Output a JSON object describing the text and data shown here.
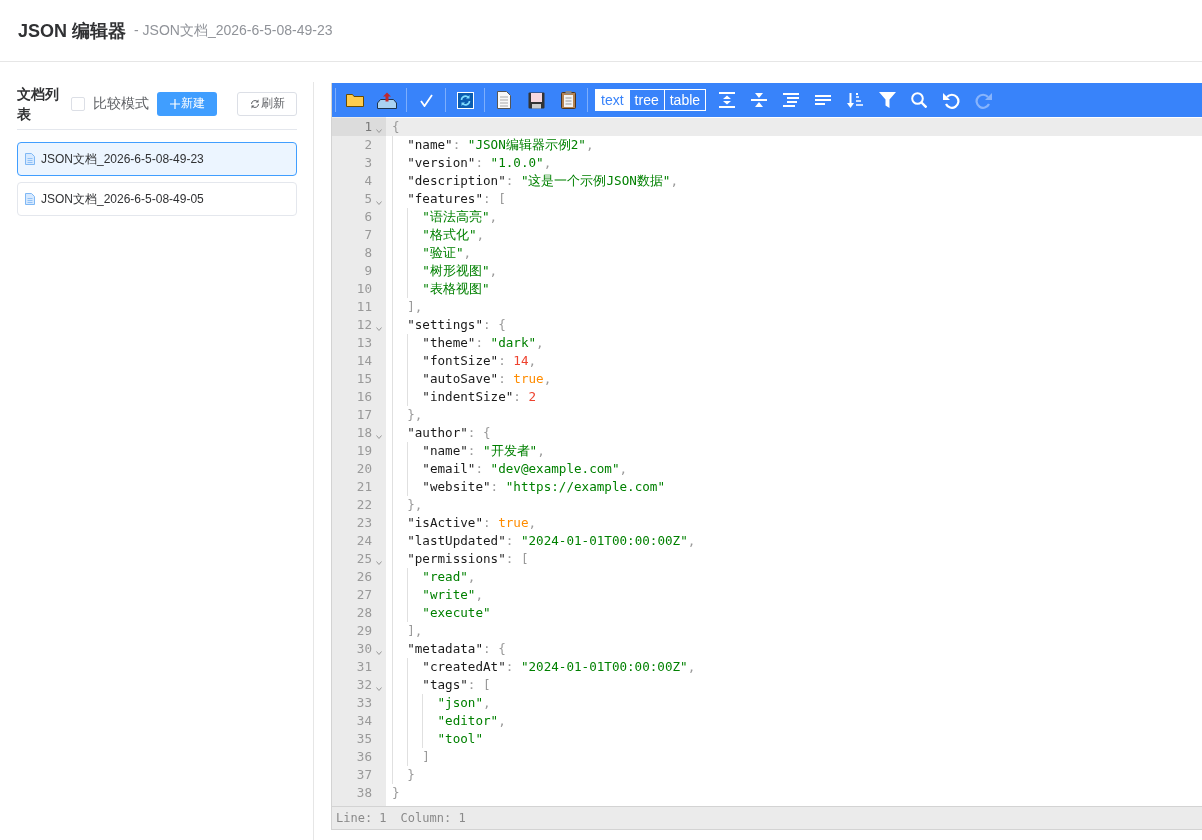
{
  "header": {
    "title": "JSON 编辑器",
    "subtitle": "- JSON文档_2026-6-5-08-49-23"
  },
  "sidebar": {
    "title": "文档列表",
    "compare": {
      "label": "比较模式",
      "checked": false
    },
    "new_button": "新建",
    "refresh_button": "刷新",
    "documents": [
      {
        "name": "JSON文档_2026-6-5-08-49-23",
        "selected": true
      },
      {
        "name": "JSON文档_2026-6-5-08-49-05",
        "selected": false
      }
    ]
  },
  "editor": {
    "toolbar": {
      "groups": [
        [
          {
            "kind": "open",
            "disabled": false
          },
          {
            "kind": "upload",
            "disabled": false
          }
        ],
        [
          {
            "kind": "validate",
            "disabled": false
          }
        ],
        [
          {
            "kind": "refresh",
            "disabled": false
          }
        ],
        [
          {
            "kind": "new",
            "disabled": false
          },
          {
            "kind": "save",
            "disabled": false
          },
          {
            "kind": "paste",
            "disabled": false
          }
        ]
      ],
      "modes": [
        {
          "label": "text",
          "selected": true
        },
        {
          "label": "tree",
          "selected": false
        },
        {
          "label": "table",
          "selected": false
        }
      ],
      "actions": [
        {
          "kind": "expand",
          "disabled": false
        },
        {
          "kind": "collapse",
          "disabled": false
        },
        {
          "kind": "format",
          "disabled": false
        },
        {
          "kind": "compact",
          "disabled": false
        },
        {
          "kind": "sort",
          "disabled": false
        },
        {
          "kind": "filter",
          "disabled": false
        },
        {
          "kind": "search",
          "disabled": false
        },
        {
          "kind": "undo",
          "disabled": false
        },
        {
          "kind": "redo",
          "disabled": true
        }
      ]
    },
    "lines": [
      {
        "number": "1",
        "active": true,
        "tokens": [
          {
            "kind": "bracket",
            "text": "{"
          }
        ],
        "children": [
          {
            "number": "2",
            "active": false,
            "tokens": [
              {
                "kind": "key",
                "text": "\"name\""
              },
              {
                "kind": "punct",
                "text": ": "
              },
              {
                "kind": "string",
                "text": "\"JSON编辑器示例2\""
              },
              {
                "kind": "punct",
                "text": ","
              }
            ]
          },
          {
            "number": "3",
            "active": false,
            "tokens": [
              {
                "kind": "key",
                "text": "\"version\""
              },
              {
                "kind": "punct",
                "text": ": "
              },
              {
                "kind": "string",
                "text": "\"1.0.0\""
              },
              {
                "kind": "punct",
                "text": ","
              }
            ]
          },
          {
            "number": "4",
            "active": false,
            "tokens": [
              {
                "kind": "key",
                "text": "\"description\""
              },
              {
                "kind": "punct",
                "text": ": "
              },
              {
                "kind": "string",
                "text": "\"这是一个示例JSON数据\""
              },
              {
                "kind": "punct",
                "text": ","
              }
            ]
          },
          {
            "number": "5",
            "active": false,
            "tokens": [
              {
                "kind": "key",
                "text": "\"features\""
              },
              {
                "kind": "punct",
                "text": ": "
              },
              {
                "kind": "bracket",
                "text": "["
              }
            ],
            "children": [
              {
                "number": "6",
                "active": false,
                "tokens": [
                  {
                    "kind": "string",
                    "text": "\"语法高亮\""
                  },
                  {
                    "kind": "punct",
                    "text": ","
                  }
                ]
              },
              {
                "number": "7",
                "active": false,
                "tokens": [
                  {
                    "kind": "string",
                    "text": "\"格式化\""
                  },
                  {
                    "kind": "punct",
                    "text": ","
                  }
                ]
              },
              {
                "number": "8",
                "active": false,
                "tokens": [
                  {
                    "kind": "string",
                    "text": "\"验证\""
                  },
                  {
                    "kind": "punct",
                    "text": ","
                  }
                ]
              },
              {
                "number": "9",
                "active": false,
                "tokens": [
                  {
                    "kind": "string",
                    "text": "\"树形视图\""
                  },
                  {
                    "kind": "punct",
                    "text": ","
                  }
                ]
              },
              {
                "number": "10",
                "active": false,
                "tokens": [
                  {
                    "kind": "string",
                    "text": "\"表格视图\""
                  }
                ]
              }
            ]
          },
          {
            "number": "11",
            "active": false,
            "tokens": [
              {
                "kind": "bracket",
                "text": "]"
              },
              {
                "kind": "punct",
                "text": ","
              }
            ]
          },
          {
            "number": "12",
            "active": false,
            "tokens": [
              {
                "kind": "key",
                "text": "\"settings\""
              },
              {
                "kind": "punct",
                "text": ": "
              },
              {
                "kind": "bracket",
                "text": "{"
              }
            ],
            "children": [
              {
                "number": "13",
                "active": false,
                "tokens": [
                  {
                    "kind": "key",
                    "text": "\"theme\""
                  },
                  {
                    "kind": "punct",
                    "text": ": "
                  },
                  {
                    "kind": "string",
                    "text": "\"dark\""
                  },
                  {
                    "kind": "punct",
                    "text": ","
                  }
                ]
              },
              {
                "number": "14",
                "active": false,
                "tokens": [
                  {
                    "kind": "key",
                    "text": "\"fontSize\""
                  },
                  {
                    "kind": "punct",
                    "text": ": "
                  },
                  {
                    "kind": "number",
                    "text": "14"
                  },
                  {
                    "kind": "punct",
                    "text": ","
                  }
                ]
              },
              {
                "number": "15",
                "active": false,
                "tokens": [
                  {
                    "kind": "key",
                    "text": "\"autoSave\""
                  },
                  {
                    "kind": "punct",
                    "text": ": "
                  },
                  {
                    "kind": "boolean",
                    "text": "true"
                  },
                  {
                    "kind": "punct",
                    "text": ","
                  }
                ]
              },
              {
                "number": "16",
                "active": false,
                "tokens": [
                  {
                    "kind": "key",
                    "text": "\"indentSize\""
                  },
                  {
                    "kind": "punct",
                    "text": ": "
                  },
                  {
                    "kind": "number",
                    "text": "2"
                  }
                ]
              }
            ]
          },
          {
            "number": "17",
            "active": false,
            "tokens": [
              {
                "kind": "bracket",
                "text": "}"
              },
              {
                "kind": "punct",
                "text": ","
              }
            ]
          },
          {
            "number": "18",
            "active": false,
            "tokens": [
              {
                "kind": "key",
                "text": "\"author\""
              },
              {
                "kind": "punct",
                "text": ": "
              },
              {
                "kind": "bracket",
                "text": "{"
              }
            ],
            "children": [
              {
                "number": "19",
                "active": false,
                "tokens": [
                  {
                    "kind": "key",
                    "text": "\"name\""
                  },
                  {
                    "kind": "punct",
                    "text": ": "
                  },
                  {
                    "kind": "string",
                    "text": "\"开发者\""
                  },
                  {
                    "kind": "punct",
                    "text": ","
                  }
                ]
              },
              {
                "number": "20",
                "active": false,
                "tokens": [
                  {
                    "kind": "key",
                    "text": "\"email\""
                  },
                  {
                    "kind": "punct",
                    "text": ": "
                  },
                  {
                    "kind": "string",
                    "text": "\"dev@example.com\""
                  },
                  {
                    "kind": "punct",
                    "text": ","
                  }
                ]
              },
              {
                "number": "21",
                "active": false,
                "tokens": [
                  {
                    "kind": "key",
                    "text": "\"website\""
                  },
                  {
                    "kind": "punct",
                    "text": ": "
                  },
                  {
                    "kind": "string",
                    "text": "\"https://example.com\""
                  }
                ]
              }
            ]
          },
          {
            "number": "22",
            "active": false,
            "tokens": [
              {
                "kind": "bracket",
                "text": "}"
              },
              {
                "kind": "punct",
                "text": ","
              }
            ]
          },
          {
            "number": "23",
            "active": false,
            "tokens": [
              {
                "kind": "key",
                "text": "\"isActive\""
              },
              {
                "kind": "punct",
                "text": ": "
              },
              {
                "kind": "boolean",
                "text": "true"
              },
              {
                "kind": "punct",
                "text": ","
              }
            ]
          },
          {
            "number": "24",
            "active": false,
            "tokens": [
              {
                "kind": "key",
                "text": "\"lastUpdated\""
              },
              {
                "kind": "punct",
                "text": ": "
              },
              {
                "kind": "string",
                "text": "\"2024-01-01T00:00:00Z\""
              },
              {
                "kind": "punct",
                "text": ","
              }
            ]
          },
          {
            "number": "25",
            "active": false,
            "tokens": [
              {
                "kind": "key",
                "text": "\"permissions\""
              },
              {
                "kind": "punct",
                "text": ": "
              },
              {
                "kind": "bracket",
                "text": "["
              }
            ],
            "children": [
              {
                "number": "26",
                "active": false,
                "tokens": [
                  {
                    "kind": "string",
                    "text": "\"read\""
                  },
                  {
                    "kind": "punct",
                    "text": ","
                  }
                ]
              },
              {
                "number": "27",
                "active": false,
                "tokens": [
                  {
                    "kind": "string",
                    "text": "\"write\""
                  },
                  {
                    "kind": "punct",
                    "text": ","
                  }
                ]
              },
              {
                "number": "28",
                "active": false,
                "tokens": [
                  {
                    "kind": "string",
                    "text": "\"execute\""
                  }
                ]
              }
            ]
          },
          {
            "number": "29",
            "active": false,
            "tokens": [
              {
                "kind": "bracket",
                "text": "]"
              },
              {
                "kind": "punct",
                "text": ","
              }
            ]
          },
          {
            "number": "30",
            "active": false,
            "tokens": [
              {
                "kind": "key",
                "text": "\"metadata\""
              },
              {
                "kind": "punct",
                "text": ": "
              },
              {
                "kind": "bracket",
                "text": "{"
              }
            ],
            "children": [
              {
                "number": "31",
                "active": false,
                "tokens": [
                  {
                    "kind": "key",
                    "text": "\"createdAt\""
                  },
                  {
                    "kind": "punct",
                    "text": ": "
                  },
                  {
                    "kind": "string",
                    "text": "\"2024-01-01T00:00:00Z\""
                  },
                  {
                    "kind": "punct",
                    "text": ","
                  }
                ]
              },
              {
                "number": "32",
                "active": false,
                "tokens": [
                  {
                    "kind": "key",
                    "text": "\"tags\""
                  },
                  {
                    "kind": "punct",
                    "text": ": "
                  },
                  {
                    "kind": "bracket",
                    "text": "["
                  }
                ],
                "children": [
                  {
                    "number": "33",
                    "active": false,
                    "tokens": [
                      {
                        "kind": "string",
                        "text": "\"json\""
                      },
                      {
                        "kind": "punct",
                        "text": ","
                      }
                    ]
                  },
                  {
                    "number": "34",
                    "active": false,
                    "tokens": [
                      {
                        "kind": "string",
                        "text": "\"editor\""
                      },
                      {
                        "kind": "punct",
                        "text": ","
                      }
                    ]
                  },
                  {
                    "number": "35",
                    "active": false,
                    "tokens": [
                      {
                        "kind": "string",
                        "text": "\"tool\""
                      }
                    ]
                  }
                ]
              },
              {
                "number": "36",
                "active": false,
                "tokens": [
                  {
                    "kind": "bracket",
                    "text": "]"
                  }
                ]
              }
            ]
          },
          {
            "number": "37",
            "active": false,
            "tokens": [
              {
                "kind": "bracket",
                "text": "}"
              }
            ]
          }
        ]
      },
      {
        "number": "38",
        "active": false,
        "tokens": [
          {
            "kind": "bracket",
            "text": "}"
          }
        ]
      }
    ],
    "status": {
      "line": "Line: 1",
      "column": "Column: 1"
    }
  }
}
